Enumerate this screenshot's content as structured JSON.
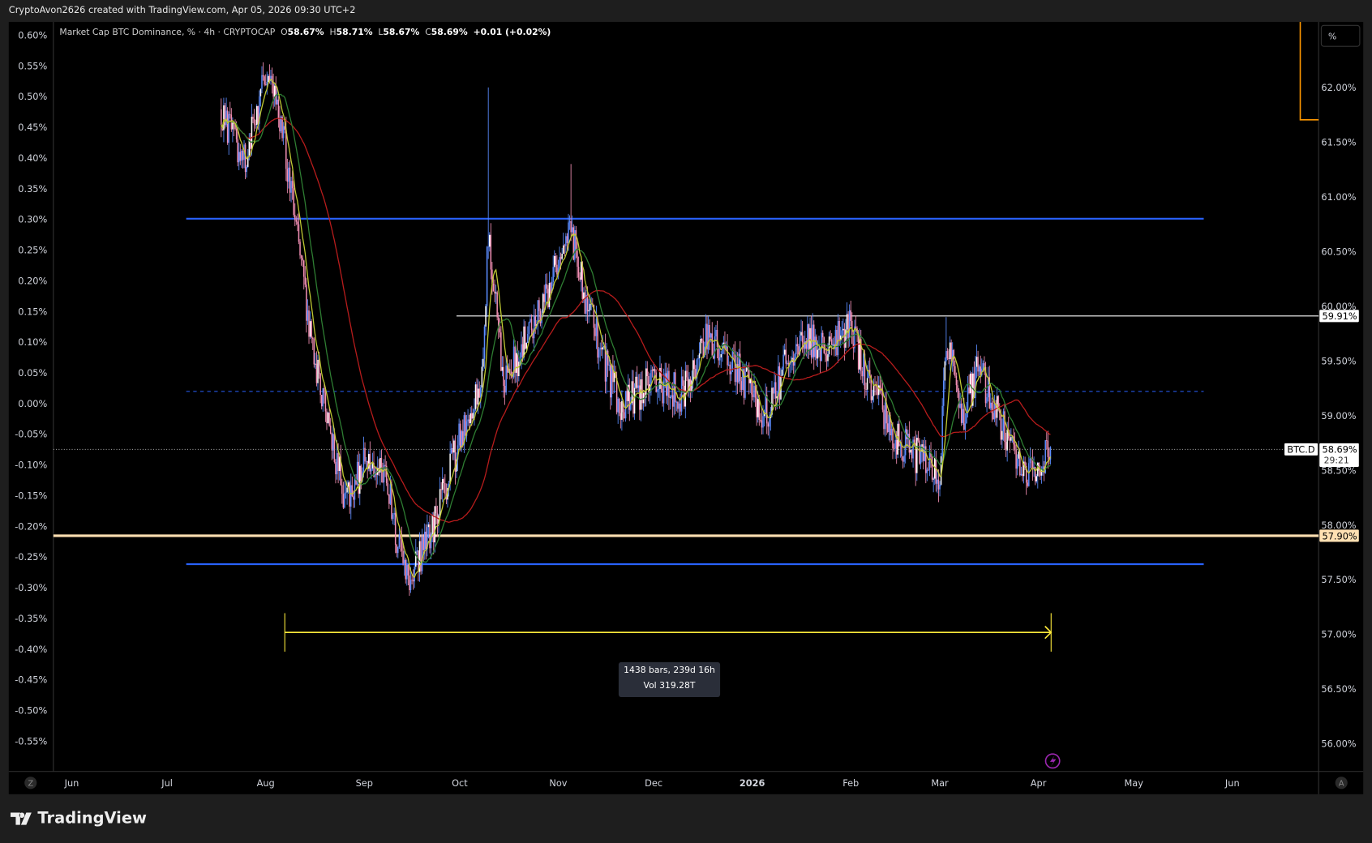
{
  "header": {
    "credit": "CryptoAvon2626 created with TradingView.com, Apr 05, 2026 09:30 UTC+2"
  },
  "legend": {
    "title": "Market Cap BTC Dominance, % · 4h · CRYPTOCAP",
    "o_label": "O",
    "o": "58.67%",
    "h_label": "H",
    "h": "58.71%",
    "l_label": "L",
    "l": "58.67%",
    "c_label": "C",
    "c": "58.69%",
    "change": "+0.01 (+0.02%)"
  },
  "scale_mode_button": "%",
  "symbol_tag": "BTC.D",
  "last_price": "58.69%",
  "countdown": "29:21",
  "level_white": "59.91%",
  "level_orange": "57.90%",
  "measure": {
    "line1": "1438 bars, 239d 16h",
    "line2": "Vol 319.28T"
  },
  "footer": {
    "brand": "TradingView"
  },
  "left_axis_corner": "Z",
  "right_axis_corner": "A",
  "colors": {
    "up": "#5b8cff",
    "down": "#f28fb4",
    "ma_slow": "#b71c1c",
    "ma_mid": "#2e7d32",
    "ma_fast": "#c0ca33",
    "blue_line": "#2962ff",
    "orange_level": "#ffe0b2",
    "measure": "#ffeb3b"
  },
  "chart_data": {
    "type": "candlestick",
    "title": "Market Cap BTC Dominance, % · 4h · CRYPTOCAP",
    "right_axis": {
      "ticks": [
        "62.00%",
        "61.50%",
        "61.00%",
        "60.50%",
        "60.00%",
        "59.50%",
        "59.00%",
        "58.50%",
        "58.00%",
        "57.50%",
        "57.00%",
        "56.50%",
        "56.00%"
      ],
      "range": [
        55.6,
        62.6
      ]
    },
    "left_axis": {
      "ticks": [
        "0.60%",
        "0.55%",
        "0.50%",
        "0.45%",
        "0.40%",
        "0.35%",
        "0.30%",
        "0.25%",
        "0.20%",
        "0.15%",
        "0.10%",
        "0.05%",
        "0.00%",
        "-0.05%",
        "-0.10%",
        "-0.15%",
        "-0.20%",
        "-0.25%",
        "-0.30%",
        "-0.35%",
        "-0.40%",
        "-0.45%",
        "-0.50%",
        "-0.55%"
      ]
    },
    "x_ticks": [
      {
        "label": "Jun",
        "date": "2025-06-01"
      },
      {
        "label": "Jul",
        "date": "2025-07-01"
      },
      {
        "label": "Aug",
        "date": "2025-08-01"
      },
      {
        "label": "Sep",
        "date": "2025-09-01"
      },
      {
        "label": "Oct",
        "date": "2025-10-01"
      },
      {
        "label": "Nov",
        "date": "2025-11-01"
      },
      {
        "label": "Dec",
        "date": "2025-12-01"
      },
      {
        "label": "2026",
        "date": "2026-01-01"
      },
      {
        "label": "Feb",
        "date": "2026-02-01"
      },
      {
        "label": "Mar",
        "date": "2026-03-01"
      },
      {
        "label": "Apr",
        "date": "2026-04-01"
      },
      {
        "label": "May",
        "date": "2026-05-01"
      },
      {
        "label": "Jun",
        "date": "2026-06-01"
      }
    ],
    "price_path": [
      [
        "2025-07-18",
        61.8
      ],
      [
        "2025-07-25",
        61.3
      ],
      [
        "2025-08-01",
        62.1
      ],
      [
        "2025-08-06",
        61.7
      ],
      [
        "2025-08-11",
        60.6
      ],
      [
        "2025-08-16",
        59.6
      ],
      [
        "2025-08-26",
        58.2
      ],
      [
        "2025-09-02",
        58.6
      ],
      [
        "2025-09-08",
        58.4
      ],
      [
        "2025-09-14",
        57.45
      ],
      [
        "2025-09-22",
        57.9
      ],
      [
        "2025-10-01",
        58.8
      ],
      [
        "2025-10-08",
        59.35
      ],
      [
        "2025-10-10",
        60.7
      ],
      [
        "2025-10-15",
        59.3
      ],
      [
        "2025-10-25",
        59.85
      ],
      [
        "2025-11-05",
        60.7
      ],
      [
        "2025-11-10",
        60.0
      ],
      [
        "2025-11-20",
        59.1
      ],
      [
        "2025-12-01",
        59.3
      ],
      [
        "2025-12-10",
        59.2
      ],
      [
        "2025-12-18",
        59.75
      ],
      [
        "2025-12-28",
        59.4
      ],
      [
        "2026-01-05",
        59.0
      ],
      [
        "2026-01-15",
        59.7
      ],
      [
        "2026-01-25",
        59.65
      ],
      [
        "2026-02-01",
        59.85
      ],
      [
        "2026-02-05",
        59.4
      ],
      [
        "2026-02-15",
        58.8
      ],
      [
        "2026-03-01",
        58.45
      ],
      [
        "2026-03-03",
        59.75
      ],
      [
        "2026-03-08",
        58.95
      ],
      [
        "2026-03-13",
        59.45
      ],
      [
        "2026-03-20",
        58.95
      ],
      [
        "2026-03-28",
        58.4
      ],
      [
        "2026-04-05",
        58.69
      ]
    ],
    "spikes": [
      [
        "2025-10-10",
        62.0
      ],
      [
        "2025-11-05",
        61.3
      ],
      [
        "2026-02-01",
        60.05
      ],
      [
        "2026-03-03",
        59.9
      ]
    ],
    "horizontal_levels": [
      {
        "name": "upper-range",
        "value": 60.8,
        "from": "2025-07-07",
        "to": "2026-05-23",
        "style": "solid",
        "color": "#2962ff"
      },
      {
        "name": "lower-range",
        "value": 57.64,
        "from": "2025-07-07",
        "to": "2026-05-23",
        "style": "solid",
        "color": "#2962ff"
      },
      {
        "name": "mid-range",
        "value": 59.22,
        "from": "2025-07-07",
        "to": "2026-05-23",
        "style": "dashed",
        "color": "#2962ff"
      },
      {
        "name": "white-level",
        "value": 59.91,
        "from": "2025-09-30",
        "style": "solid",
        "color": "#ffffff"
      },
      {
        "name": "orange-level",
        "value": 57.9,
        "style": "solid",
        "color": "#ffe0b2"
      }
    ],
    "measure_range": {
      "from": "2025-08-07",
      "to": "2026-04-05",
      "bars": 1438
    }
  }
}
